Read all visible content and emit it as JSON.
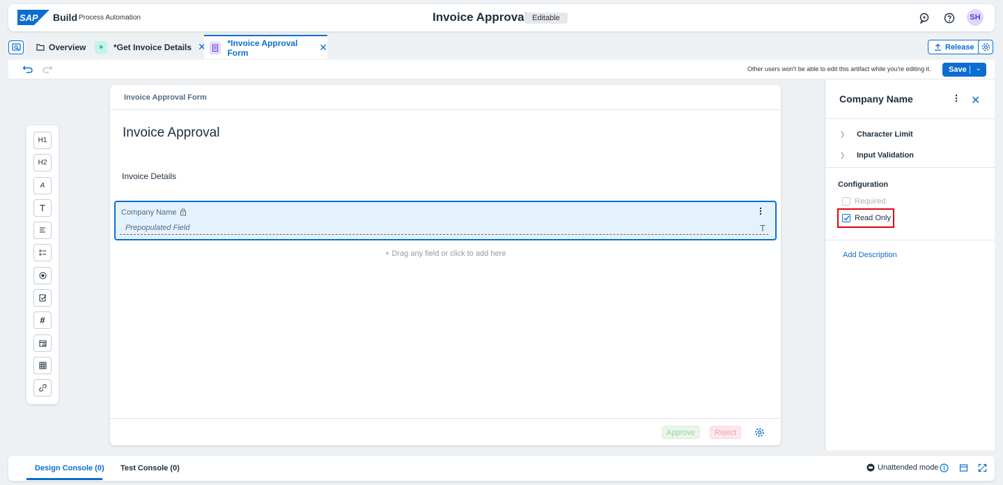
{
  "shell": {
    "brand_logo": "SAP",
    "brand": "Build",
    "subbrand": "Process Automation",
    "title": "Invoice Approval",
    "status_badge": "Editable",
    "avatar_initials": "SH"
  },
  "tabs": {
    "overview": "Overview",
    "get_invoice_details": "*Get Invoice Details",
    "invoice_approval_form": "*Invoice Approval Form",
    "release_label": "Release"
  },
  "toolbar": {
    "lock_note": "Other users won't be able to edit this artifact while you're editing it.",
    "save_label": "Save"
  },
  "palette": {
    "items": [
      "H1",
      "H2",
      "A",
      "T"
    ]
  },
  "form": {
    "header": "Invoice Approval Form",
    "title": "Invoice Approval",
    "section_title": "Invoice Details",
    "field_label": "Company Name",
    "field_placeholder": "Prepopulated Field",
    "field_type_glyph": "T",
    "drag_hint": "+ Drag any field or click to add here",
    "approve_label": "Approve",
    "reject_label": "Reject"
  },
  "panel": {
    "title": "Company Name",
    "accordions": [
      "Character Limit",
      "Input Validation"
    ],
    "config_title": "Configuration",
    "required_label": "Required",
    "required_checked": false,
    "read_only_label": "Read Only",
    "read_only_checked": true,
    "add_description": "Add Description"
  },
  "console": {
    "design_tab": "Design Console (0)",
    "test_tab": "Test Console (0)",
    "unattended_label": "Unattended mode"
  },
  "colors": {
    "accent": "#0a6ed1",
    "highlight_red": "#e4000f",
    "field_bg": "#e4f2fd"
  }
}
